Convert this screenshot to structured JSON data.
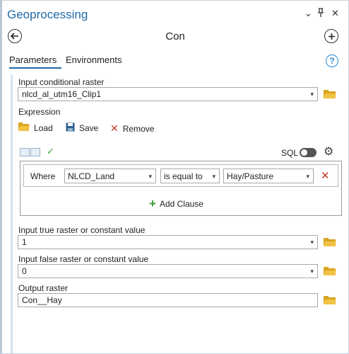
{
  "pane": {
    "title": "Geoprocessing",
    "controls": {
      "menu": "⌄",
      "pin": "⊥",
      "close": "✕"
    }
  },
  "tool": {
    "name": "Con",
    "back_icon": "back-arrow-icon",
    "add_icon": "plus-circle-icon"
  },
  "tabs": [
    {
      "label": "Parameters",
      "active": true
    },
    {
      "label": "Environments",
      "active": false
    }
  ],
  "params": {
    "input_conditional_raster": {
      "label": "Input conditional raster",
      "value": "nlcd_al_utm16_Clip1"
    },
    "expression": {
      "label": "Expression",
      "load": "Load",
      "save": "Save",
      "remove": "Remove",
      "sql_label": "SQL",
      "clause": {
        "where": "Where",
        "field": "NLCD_Land",
        "operator": "is equal to",
        "value": "Hay/Pasture"
      },
      "add_clause": "Add Clause"
    },
    "input_true": {
      "label": "Input true raster or constant value",
      "value": "1"
    },
    "input_false": {
      "label": "Input false raster or constant value",
      "value": "0"
    },
    "output": {
      "label": "Output raster",
      "value": "Con__Hay"
    }
  },
  "colors": {
    "accent": "#1f6aa8",
    "folder": "#f2c244",
    "remove": "#c0392b",
    "add": "#3a9a3a"
  }
}
